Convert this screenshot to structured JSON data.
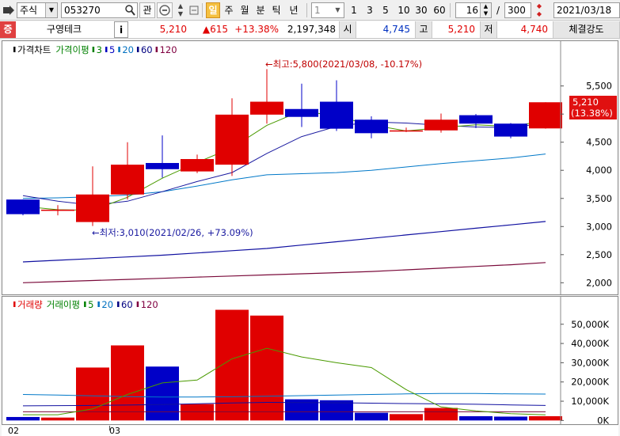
{
  "toolbar": {
    "market_type": "주식",
    "stock_code": "053270",
    "search_icon_label": "search-icon",
    "watch_label": "관",
    "period_active": "일",
    "periods": [
      "주",
      "월",
      "분",
      "틱",
      "년"
    ],
    "interval_value": "1",
    "intervals": [
      "1",
      "3",
      "5",
      "10",
      "30",
      "60"
    ],
    "count_value": "16",
    "count_divider": "/",
    "total_value": "300",
    "date_value": "2021/03/18"
  },
  "quote": {
    "badge": "증",
    "name": "구영테크",
    "info_button": "i",
    "price": "5,210",
    "change": "▲615",
    "change_pct": "+13.38%",
    "volume": "2,197,348",
    "open_label": "시",
    "open": "4,745",
    "high_label": "고",
    "high": "5,210",
    "low_label": "저",
    "low": "4,740",
    "strength_label": "체결강도"
  },
  "price_legend": [
    {
      "text": "가격차트",
      "color": "#000000"
    },
    {
      "text": "가격이평",
      "color": "#008000"
    },
    {
      "text": "3",
      "color": "#008000"
    },
    {
      "text": "5",
      "color": "#0000c0"
    },
    {
      "text": "20",
      "color": "#0070c0"
    },
    {
      "text": "60",
      "color": "#000080"
    },
    {
      "text": "120",
      "color": "#800040"
    }
  ],
  "volume_legend": [
    {
      "text": "거래량",
      "color": "#e00000"
    },
    {
      "text": "거래이평",
      "color": "#008000"
    },
    {
      "text": "5",
      "color": "#008000"
    },
    {
      "text": "20",
      "color": "#0070c0"
    },
    {
      "text": "60",
      "color": "#000080"
    },
    {
      "text": "120",
      "color": "#800040"
    }
  ],
  "annotations": {
    "high": "←최고:5,800(2021/03/08, -10.17%)",
    "low": "←최저:3,010(2021/02/26, +73.09%)",
    "last_price": "5,210",
    "last_pct": "(13.38%)"
  },
  "x_labels": [
    "02",
    "03"
  ],
  "colors": {
    "up": "#e00000",
    "down": "#0000c8",
    "ma3": "#4a9a00",
    "ma5": "#1a1aa0",
    "ma20": "#0078c8",
    "ma60": "#1010a0",
    "ma120": "#7a0a3a"
  },
  "chart_data": [
    {
      "type": "candlestick",
      "ylim": [
        1850,
        6100
      ],
      "yticks": [
        2000,
        2500,
        3000,
        3500,
        4000,
        4500,
        5000,
        5500
      ],
      "ytick_labels": [
        "2,000",
        "2,500",
        "3,000",
        "3,500",
        "4,000",
        "4,500",
        "5,000",
        "5,500"
      ],
      "candles": [
        {
          "open": 3480,
          "close": 3220,
          "high": 3480,
          "low": 3200
        },
        {
          "open": 3300,
          "close": 3300,
          "high": 3380,
          "low": 3200
        },
        {
          "open": 3080,
          "close": 3570,
          "high": 4070,
          "low": 3010
        },
        {
          "open": 3570,
          "close": 4100,
          "high": 4500,
          "low": 3480
        },
        {
          "open": 4130,
          "close": 4020,
          "high": 4620,
          "low": 3870
        },
        {
          "open": 3980,
          "close": 4200,
          "high": 4280,
          "low": 3950
        },
        {
          "open": 4100,
          "close": 4990,
          "high": 5280,
          "low": 3900
        },
        {
          "open": 4990,
          "close": 5220,
          "high": 5800,
          "low": 4830
        },
        {
          "open": 5090,
          "close": 4950,
          "high": 5540,
          "low": 4770
        },
        {
          "open": 5220,
          "close": 4740,
          "high": 5600,
          "low": 4700
        },
        {
          "open": 4900,
          "close": 4660,
          "high": 4960,
          "low": 4570
        },
        {
          "open": 4710,
          "close": 4710,
          "high": 4760,
          "low": 4680
        },
        {
          "open": 4710,
          "close": 4900,
          "high": 5010,
          "low": 4670
        },
        {
          "open": 4980,
          "close": 4830,
          "high": 5000,
          "low": 4750
        },
        {
          "open": 4830,
          "close": 4600,
          "high": 4840,
          "low": 4570
        },
        {
          "open": 4745,
          "close": 5210,
          "high": 5210,
          "low": 4740
        }
      ],
      "ma3": [
        3360,
        3300,
        3290,
        3520,
        3860,
        4140,
        4400,
        4800,
        5060,
        4960,
        4810,
        4700,
        4760,
        4810,
        4780,
        4880
      ],
      "ma5": [
        3550,
        3450,
        3380,
        3450,
        3620,
        3800,
        3960,
        4300,
        4600,
        4780,
        4860,
        4840,
        4800,
        4770,
        4760,
        4840
      ],
      "ma20": [
        3500,
        3510,
        3530,
        3560,
        3620,
        3720,
        3830,
        3920,
        3940,
        3960,
        4000,
        4060,
        4120,
        4170,
        4220,
        4290
      ],
      "ma60": [
        2370,
        2400,
        2430,
        2460,
        2490,
        2530,
        2570,
        2610,
        2670,
        2730,
        2790,
        2850,
        2910,
        2970,
        3030,
        3090
      ],
      "ma120": [
        2000,
        2020,
        2040,
        2060,
        2080,
        2100,
        2120,
        2140,
        2160,
        2180,
        2200,
        2230,
        2260,
        2290,
        2320,
        2360
      ]
    },
    {
      "type": "bar",
      "ylim": [
        -1500,
        61000
      ],
      "yticks": [
        0,
        10000,
        20000,
        30000,
        40000,
        50000
      ],
      "ytick_labels": [
        "0K",
        "10,000K",
        "20,000K",
        "30,000K",
        "40,000K",
        "50,000K"
      ],
      "volumes": [
        1800,
        1500,
        27500,
        39000,
        28000,
        8500,
        57500,
        54500,
        11000,
        10500,
        4000,
        3300,
        6500,
        2200,
        2000,
        2200
      ],
      "ma5": [
        3000,
        3000,
        6000,
        13500,
        19500,
        21000,
        32000,
        37500,
        33000,
        30000,
        27500,
        16000,
        7000,
        5000,
        3500,
        2900
      ],
      "ma20": [
        13500,
        13200,
        12800,
        12400,
        12200,
        12200,
        12300,
        12600,
        12900,
        13200,
        13500,
        13800,
        14000,
        14000,
        13800,
        13700
      ],
      "ma60": [
        7600,
        7700,
        7800,
        8000,
        8300,
        8700,
        9100,
        9400,
        9300,
        9200,
        9000,
        8800,
        8600,
        8400,
        8100,
        7800
      ],
      "ma120": [
        4500,
        4500,
        4500,
        4500,
        4500,
        4500,
        4500,
        4500,
        4500,
        4500,
        4500,
        4500,
        4500,
        4500,
        4500,
        4500
      ]
    }
  ]
}
